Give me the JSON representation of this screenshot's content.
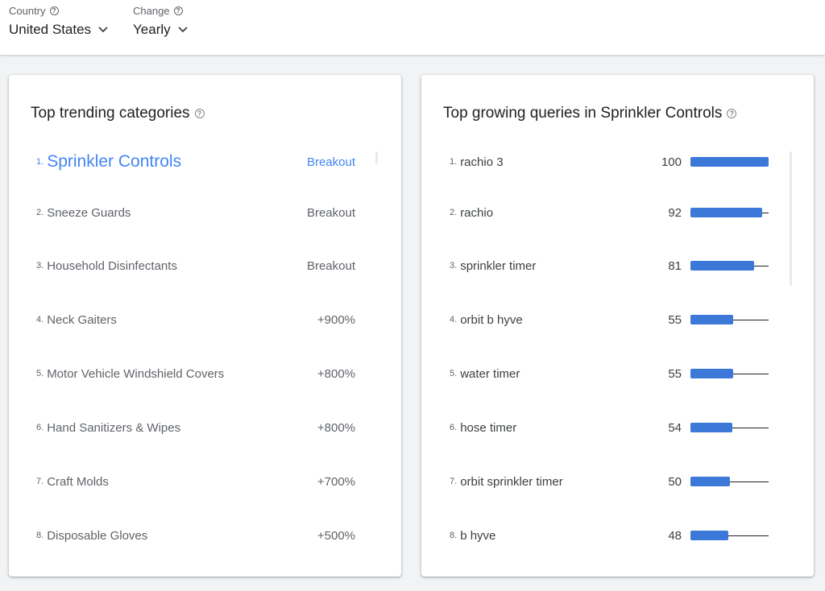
{
  "filters": {
    "country": {
      "label": "Country",
      "value": "United States",
      "help_icon": "help-circle-icon",
      "chevron": "chevron-down-icon"
    },
    "change": {
      "label": "Change",
      "value": "Yearly",
      "help_icon": "help-circle-icon",
      "chevron": "chevron-down-icon"
    }
  },
  "categories_card": {
    "title": "Top trending categories",
    "items": [
      {
        "rank": "1.",
        "name": "Sprinkler Controls",
        "value": "Breakout",
        "active": true
      },
      {
        "rank": "2.",
        "name": "Sneeze Guards",
        "value": "Breakout"
      },
      {
        "rank": "3.",
        "name": "Household Disinfectants",
        "value": "Breakout"
      },
      {
        "rank": "4.",
        "name": "Neck Gaiters",
        "value": "+900%"
      },
      {
        "rank": "5.",
        "name": "Motor Vehicle Windshield Covers",
        "value": "+800%"
      },
      {
        "rank": "6.",
        "name": "Hand Sanitizers & Wipes",
        "value": "+800%"
      },
      {
        "rank": "7.",
        "name": "Craft Molds",
        "value": "+700%"
      },
      {
        "rank": "8.",
        "name": "Disposable Gloves",
        "value": "+500%"
      }
    ]
  },
  "queries_card": {
    "title": "Top growing queries in Sprinkler Controls",
    "items": [
      {
        "rank": "1.",
        "query": "rachio 3",
        "value": "100",
        "level": 100
      },
      {
        "rank": "2.",
        "query": "rachio",
        "value": "92",
        "level": 92
      },
      {
        "rank": "3.",
        "query": "sprinkler timer",
        "value": "81",
        "level": 81
      },
      {
        "rank": "4.",
        "query": "orbit b hyve",
        "value": "55",
        "level": 55
      },
      {
        "rank": "5.",
        "query": "water timer",
        "value": "55",
        "level": 55
      },
      {
        "rank": "6.",
        "query": "hose timer",
        "value": "54",
        "level": 54
      },
      {
        "rank": "7.",
        "query": "orbit sprinkler timer",
        "value": "50",
        "level": 50
      },
      {
        "rank": "8.",
        "query": "b hyve",
        "value": "48",
        "level": 48
      }
    ]
  },
  "colors": {
    "accent": "#4285f4",
    "bar": "#3c78d8"
  }
}
